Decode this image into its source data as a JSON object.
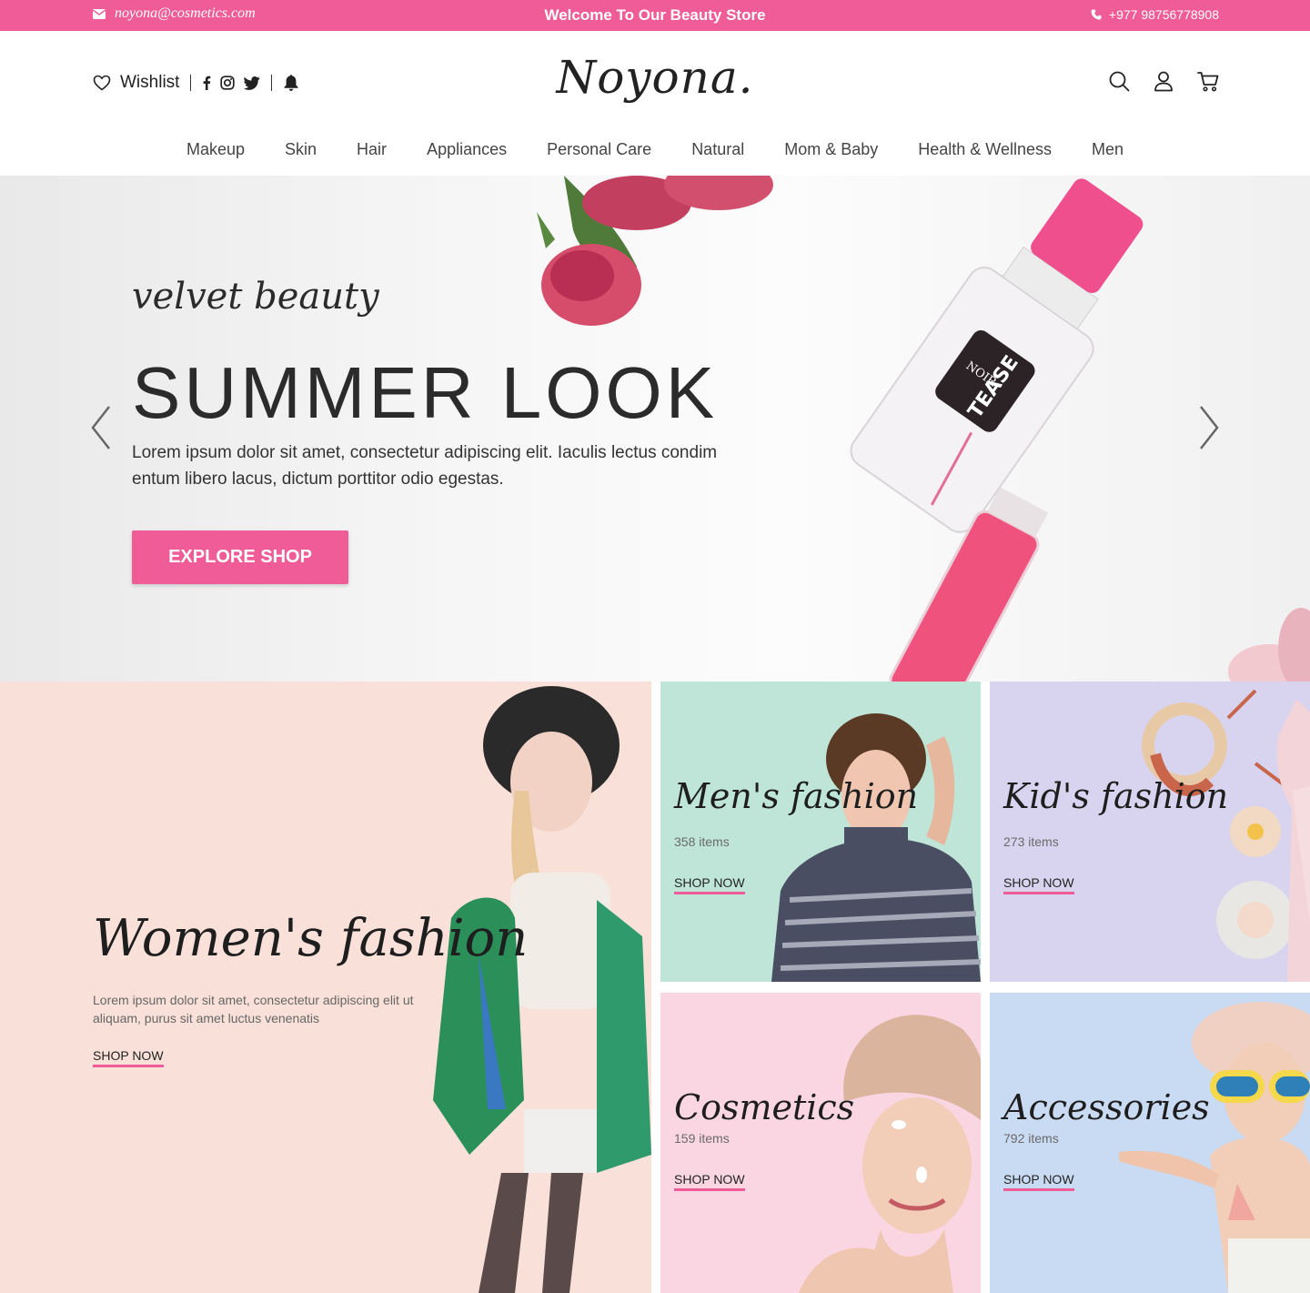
{
  "topbar": {
    "email": "noyona@cosmetics.com",
    "welcome": "Welcome To Our Beauty Store",
    "phone": "+977 98756778908"
  },
  "header": {
    "wishlist": "Wishlist",
    "logo": "Noyona."
  },
  "nav": [
    "Makeup",
    "Skin",
    "Hair",
    "Appliances",
    "Personal Care",
    "Natural",
    "Mom & Baby",
    "Health & Wellness",
    "Men"
  ],
  "hero": {
    "tagline": "velvet beauty",
    "title": "SUMMER LOOK",
    "description": "Lorem ipsum dolor sit amet, consectetur adipiscing elit. Iaculis lectus condim entum libero lacus, dictum porttitor odio egestas.",
    "cta": "EXPLORE SHOP",
    "bottle_label_1": "NOIR",
    "bottle_label_2": "TEASE"
  },
  "categories": {
    "women": {
      "name": "Women's fashion",
      "description": "Lorem ipsum dolor sit amet, consectetur adipiscing elit ut aliquam, purus sit amet luctus venenatis",
      "shop": "SHOP NOW"
    },
    "men": {
      "name": "Men's fashion",
      "count": "358 items",
      "shop": "SHOP NOW"
    },
    "kids": {
      "name": "Kid's fashion",
      "count": "273 items",
      "shop": "SHOP NOW"
    },
    "cosmetics": {
      "name": "Cosmetics",
      "count": "159 items",
      "shop": "SHOP NOW"
    },
    "accessories": {
      "name": "Accessories",
      "count": "792 items",
      "shop": "SHOP NOW"
    }
  },
  "colors": {
    "accent": "#ef5c97",
    "women_bg": "#f9e1d9",
    "men_bg": "#bfe5d9",
    "kids_bg": "#d8d4ef",
    "cosmetics_bg": "#fad6e3",
    "accessories_bg": "#c9daf3"
  },
  "icons": [
    "mail-icon",
    "phone-icon",
    "heart-icon",
    "facebook-icon",
    "instagram-icon",
    "twitter-icon",
    "bell-icon",
    "search-icon",
    "user-icon",
    "cart-icon",
    "chevron-left-icon",
    "chevron-right-icon"
  ]
}
